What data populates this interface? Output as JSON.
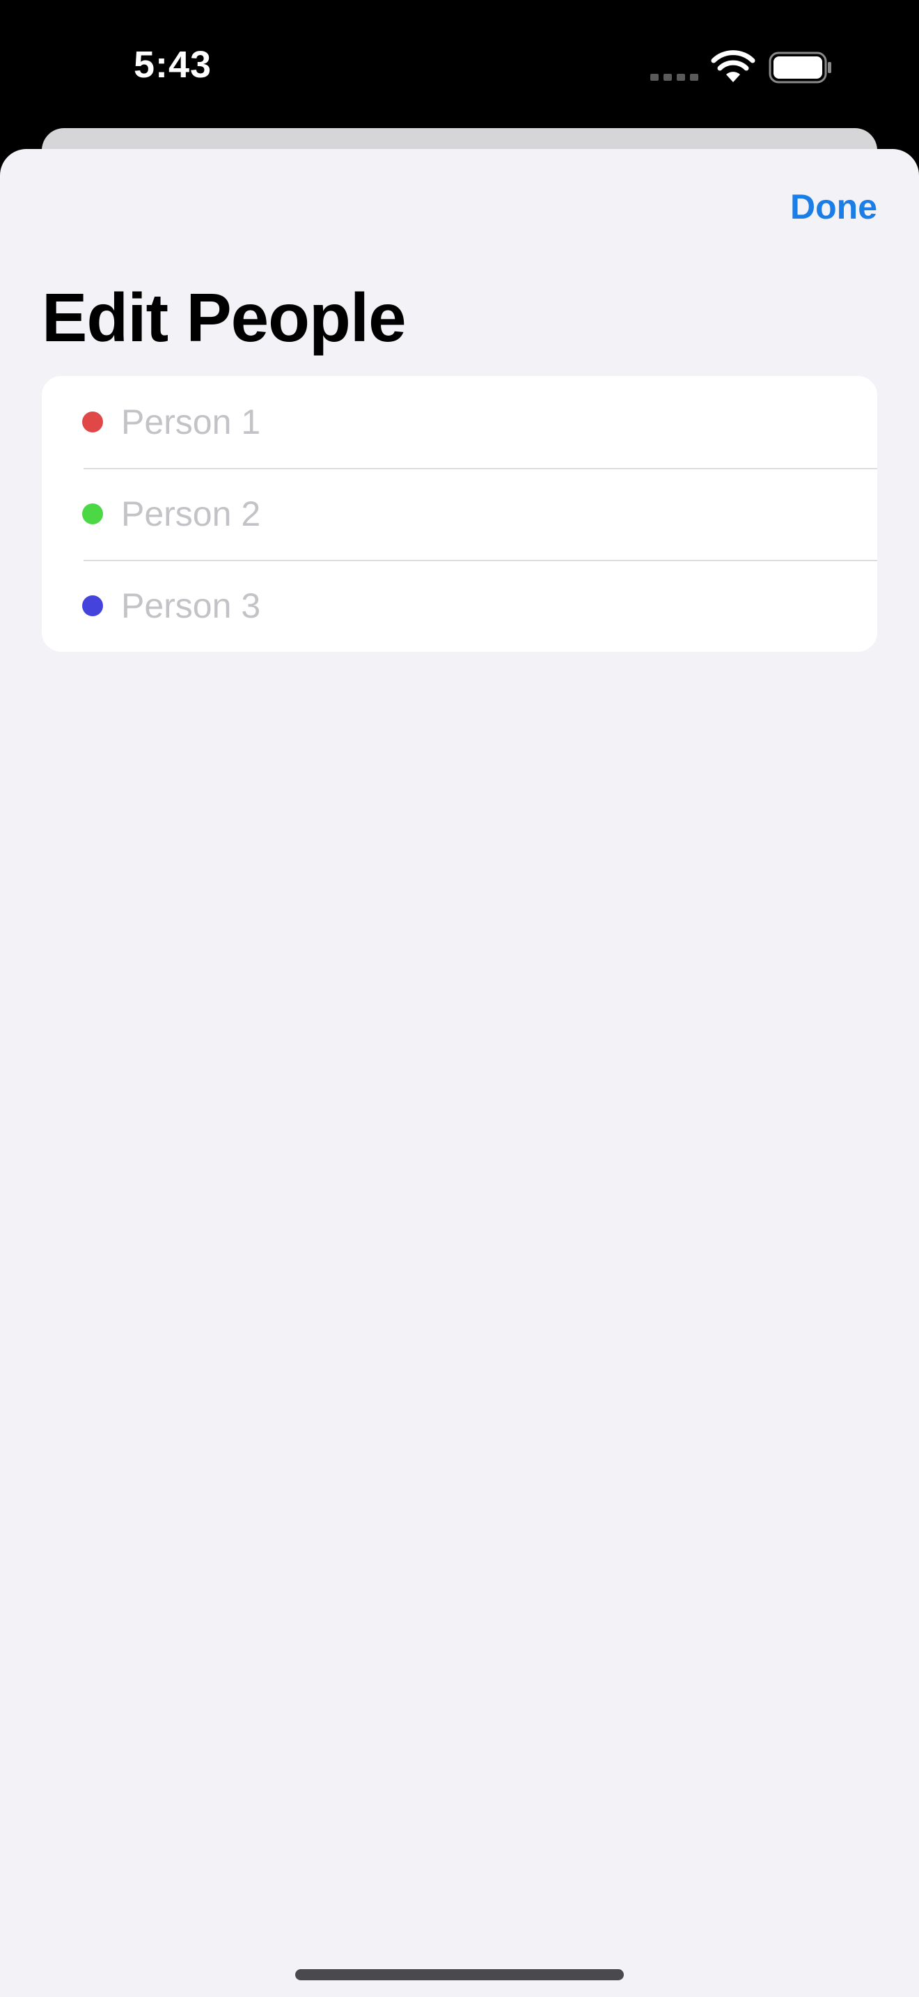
{
  "status_bar": {
    "time": "5:43",
    "icons": [
      "cellular-signal-icon",
      "wifi-icon",
      "battery-icon"
    ]
  },
  "header": {
    "done_label": "Done",
    "title": "Edit People"
  },
  "people": [
    {
      "placeholder": "Person 1",
      "value": "",
      "color": "#e04848"
    },
    {
      "placeholder": "Person 2",
      "value": "",
      "color": "#4cd844"
    },
    {
      "placeholder": "Person 3",
      "value": "",
      "color": "#4444dd"
    }
  ],
  "colors": {
    "accent": "#1a7ee6",
    "sheet_background": "#f2f2f7"
  }
}
